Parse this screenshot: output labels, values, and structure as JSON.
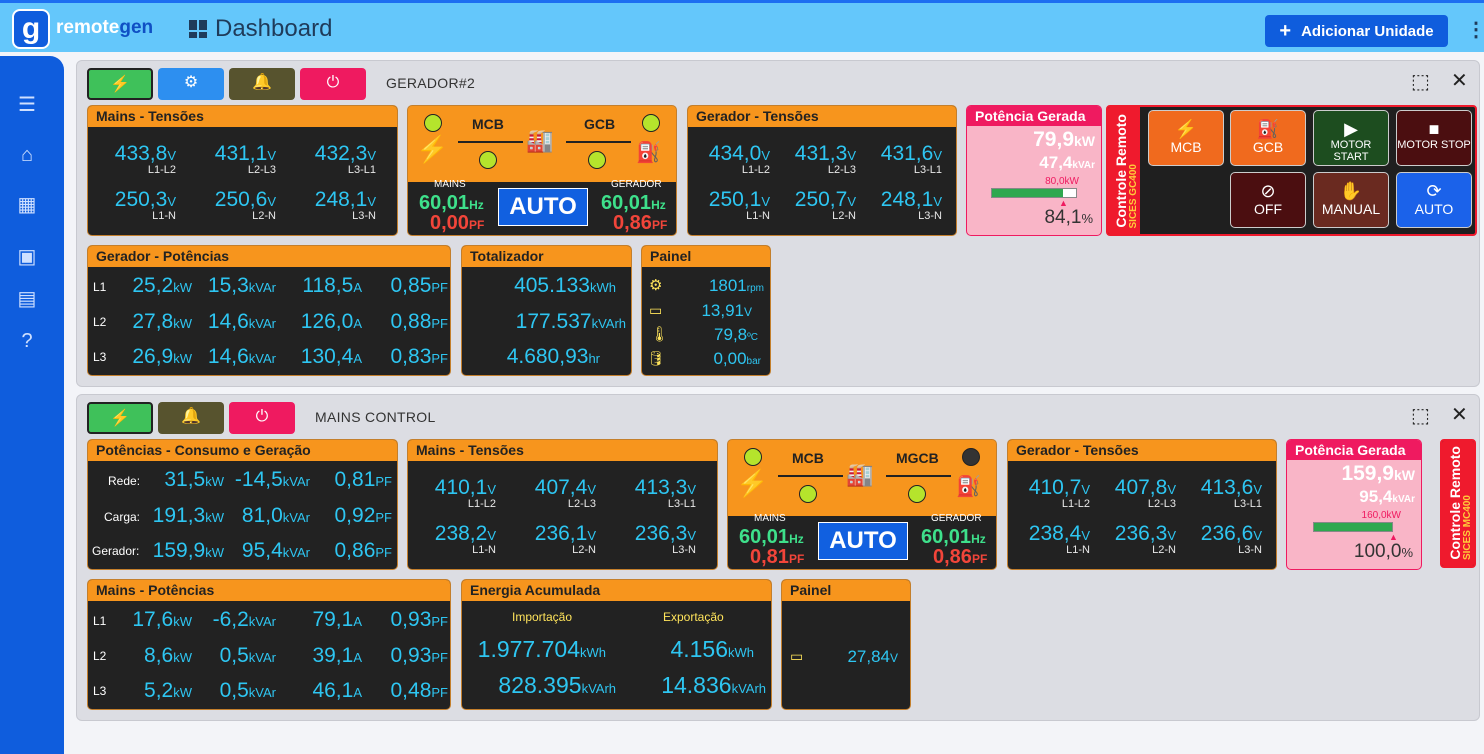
{
  "app": {
    "logo_letter": "g",
    "logo_name_a": "remote",
    "logo_name_b": "gen",
    "page_title": "Dashboard",
    "add_button": "Adicionar Unidade"
  },
  "icons": {
    "menu": "menu-icon",
    "home": "home-icon",
    "dashboard": "dashboard-icon",
    "contact": "contact-icon",
    "document": "document-icon",
    "help": "help-icon"
  },
  "colors": {
    "accent": "#0f5ddd",
    "header": "#64c7fb",
    "panel_header": "#f7951d",
    "panel_body": "#222222",
    "cyan": "#2ec6f2",
    "green": "#3ee08b",
    "red": "#f2453a",
    "pink": "#ef1a60"
  },
  "unit1": {
    "title": "GERADOR#2",
    "mains_voltages": {
      "header": "Mains - Tensões",
      "cells": [
        {
          "v": "433,8",
          "u": "V",
          "l": "L1-L2"
        },
        {
          "v": "431,1",
          "u": "V",
          "l": "L2-L3"
        },
        {
          "v": "432,3",
          "u": "V",
          "l": "L3-L1"
        },
        {
          "v": "250,3",
          "u": "V",
          "l": "L1-N"
        },
        {
          "v": "250,6",
          "u": "V",
          "l": "L2-N"
        },
        {
          "v": "248,1",
          "u": "V",
          "l": "L3-N"
        }
      ]
    },
    "flow": {
      "left": "MCB",
      "right": "GCB",
      "mains_label": "MAINS",
      "gen_label": "GERADOR",
      "mains_hz": "60,01",
      "mains_pf": "0,00",
      "gen_hz": "60,01",
      "gen_pf": "0,86",
      "hz": "Hz",
      "pf": "PF",
      "mode": "AUTO"
    },
    "gen_voltages": {
      "header": "Gerador - Tensões",
      "cells": [
        {
          "v": "434,0",
          "u": "V",
          "l": "L1-L2"
        },
        {
          "v": "431,3",
          "u": "V",
          "l": "L2-L3"
        },
        {
          "v": "431,6",
          "u": "V",
          "l": "L3-L1"
        },
        {
          "v": "250,1",
          "u": "V",
          "l": "L1-N"
        },
        {
          "v": "250,7",
          "u": "V",
          "l": "L2-N"
        },
        {
          "v": "248,1",
          "u": "V",
          "l": "L3-N"
        }
      ]
    },
    "power": {
      "header": "Potência Gerada",
      "kw": "79,9",
      "kw_u": "kW",
      "kvar": "47,4",
      "kvar_u": "kVAr",
      "nominal": "80,0kW",
      "pct": "84,1",
      "pct_u": "%",
      "fill": 0.841
    },
    "remote": {
      "title": "Controle Remoto",
      "model": "SICES GC400",
      "buttons": [
        "MCB",
        "GCB",
        "MOTOR START",
        "MOTOR STOP",
        "OFF",
        "MANUAL",
        "AUTO"
      ]
    },
    "gen_power": {
      "header": "Gerador - Potências",
      "rows": [
        {
          "l": "L1",
          "kw": "25,2",
          "kvar": "15,3",
          "a": "118,5",
          "pf": "0,85"
        },
        {
          "l": "L2",
          "kw": "27,8",
          "kvar": "14,6",
          "a": "126,0",
          "pf": "0,88"
        },
        {
          "l": "L3",
          "kw": "26,9",
          "kvar": "14,6",
          "a": "130,4",
          "pf": "0,83"
        }
      ]
    },
    "totalizer": {
      "header": "Totalizador",
      "kwh": "405.133",
      "kwh_u": "kWh",
      "kvarh": "177.537",
      "kvarh_u": "kVArh",
      "hr": "4.680,93",
      "hr_u": "hr"
    },
    "panel": {
      "header": "Painel",
      "rpm": "1801",
      "rpm_u": "rpm",
      "batt": "13,91",
      "batt_u": "V",
      "temp": "79,8",
      "temp_u": "ºC",
      "oil": "0,00",
      "oil_u": "bar"
    }
  },
  "unit2": {
    "title": "MAINS CONTROL",
    "consumption": {
      "header": "Potências - Consumo e Geração",
      "rows": [
        {
          "l": "Rede:",
          "kw": "31,5",
          "kvar": "-14,5",
          "pf": "0,81"
        },
        {
          "l": "Carga:",
          "kw": "191,3",
          "kvar": "81,0",
          "pf": "0,92"
        },
        {
          "l": "Gerador:",
          "kw": "159,9",
          "kvar": "95,4",
          "pf": "0,86"
        }
      ]
    },
    "mains_voltages": {
      "header": "Mains - Tensões",
      "cells": [
        {
          "v": "410,1",
          "u": "V",
          "l": "L1-L2"
        },
        {
          "v": "407,4",
          "u": "V",
          "l": "L2-L3"
        },
        {
          "v": "413,3",
          "u": "V",
          "l": "L3-L1"
        },
        {
          "v": "238,2",
          "u": "V",
          "l": "L1-N"
        },
        {
          "v": "236,1",
          "u": "V",
          "l": "L2-N"
        },
        {
          "v": "236,3",
          "u": "V",
          "l": "L3-N"
        }
      ]
    },
    "flow": {
      "left": "MCB",
      "right": "MGCB",
      "mains_label": "MAINS",
      "gen_label": "GERADOR",
      "mains_hz": "60,01",
      "mains_pf": "0,81",
      "gen_hz": "60,01",
      "gen_pf": "0,86",
      "hz": "Hz",
      "pf": "PF",
      "mode": "AUTO"
    },
    "gen_voltages": {
      "header": "Gerador - Tensões",
      "cells": [
        {
          "v": "410,7",
          "u": "V",
          "l": "L1-L2"
        },
        {
          "v": "407,8",
          "u": "V",
          "l": "L2-L3"
        },
        {
          "v": "413,6",
          "u": "V",
          "l": "L3-L1"
        },
        {
          "v": "238,4",
          "u": "V",
          "l": "L1-N"
        },
        {
          "v": "236,3",
          "u": "V",
          "l": "L2-N"
        },
        {
          "v": "236,6",
          "u": "V",
          "l": "L3-N"
        }
      ]
    },
    "power": {
      "header": "Potência Gerada",
      "kw": "159,9",
      "kw_u": "kW",
      "kvar": "95,4",
      "kvar_u": "kVAr",
      "nominal": "160,0kW",
      "pct": "100,0",
      "pct_u": "%",
      "fill": 1.0
    },
    "remote": {
      "title": "Controle Remoto",
      "model": "SICES MC400"
    },
    "mains_power": {
      "header": "Mains - Potências",
      "rows": [
        {
          "l": "L1",
          "kw": "17,6",
          "kvar": "-6,2",
          "a": "79,1",
          "pf": "0,93"
        },
        {
          "l": "L2",
          "kw": "8,6",
          "kvar": "0,5",
          "a": "39,1",
          "pf": "0,93"
        },
        {
          "l": "L3",
          "kw": "5,2",
          "kvar": "0,5",
          "a": "46,1",
          "pf": "0,48"
        }
      ]
    },
    "energy": {
      "header": "Energia Acumulada",
      "import_label": "Importação",
      "export_label": "Exportação",
      "imp_kwh": "1.977.704",
      "imp_kvarh": "828.395",
      "exp_kwh": "4.156",
      "exp_kvarh": "14.836",
      "kwh_u": "kWh",
      "kvarh_u": "kVArh"
    },
    "panel": {
      "header": "Painel",
      "batt": "27,84",
      "batt_u": "V"
    }
  },
  "units": {
    "kw": "kW",
    "kvar": "kVAr",
    "a": "A",
    "pf": "PF"
  }
}
